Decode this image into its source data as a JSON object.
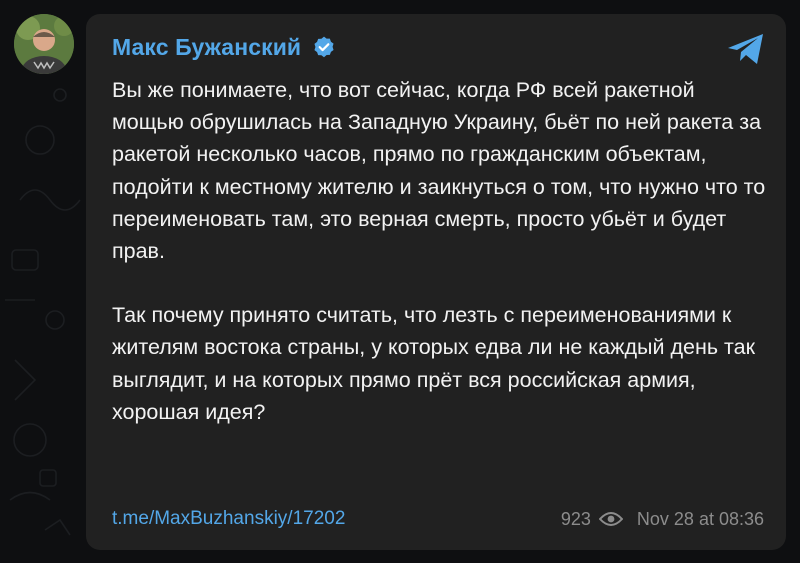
{
  "post": {
    "author": "Макс Бужанский",
    "verified_icon": "verified-badge-icon",
    "app_icon": "telegram-icon",
    "paragraphs": [
      "Вы же понимаете, что вот сейчас, когда РФ всей ракетной мощью обрушилась на Западную Украину, бьёт по ней ракета за ракетой несколько часов, прямо по гражданским объектам, подойти к местному жителю и заикнуться о том, что нужно что то переименовать там, это верная смерть, просто убьёт и будет прав.",
      "Так почему принято считать, что лезть с переименованиями к жителям востока страны, у которых едва ли не каждый день так выглядит, и на которых прямо прёт вся российская армия, хорошая идея?"
    ],
    "link": "t.me/MaxBuzhanskiy/17202",
    "views": "923",
    "views_icon": "eye-icon",
    "date": "Nov 28 at 08:36"
  },
  "colors": {
    "background": "#0e0f11",
    "bubble": "#212121",
    "accent": "#53a7e8",
    "text": "#f2f2f2",
    "meta": "#8c8c8c"
  }
}
